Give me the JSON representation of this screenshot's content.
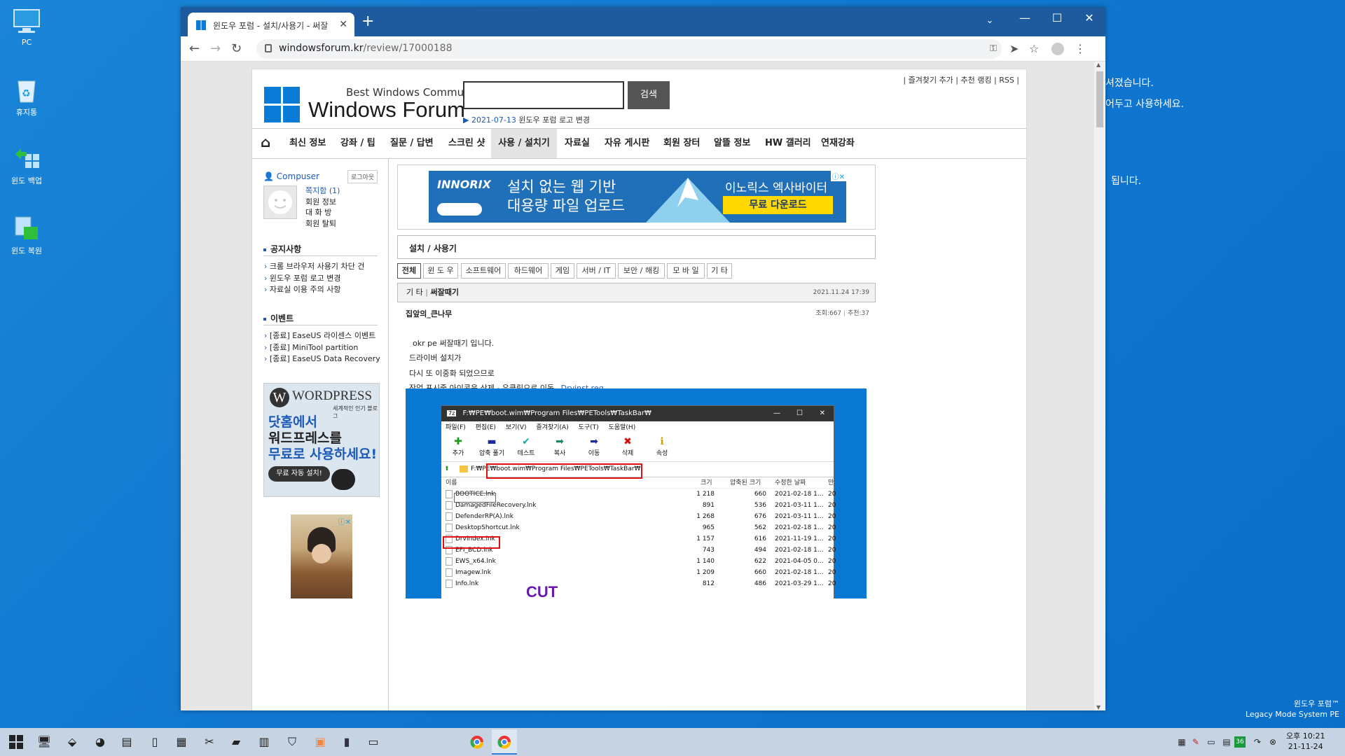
{
  "desktop": {
    "icons": [
      {
        "label": "PC"
      },
      {
        "label": "휴지통"
      },
      {
        "label": "윈도 백업"
      },
      {
        "label": "윈도 복원"
      }
    ],
    "bg_lines": [
      "셔졌습니다.",
      "어두고 사용하세요.",
      "됩니다."
    ],
    "watermark": {
      "line1": "윈도우 포럼™",
      "line2": "Legacy Mode System PE"
    }
  },
  "browser": {
    "tab_title": "윈도우 포럼 - 설치/사용기 - 써잘",
    "url_host": "windowsforum.kr",
    "url_path": "/review/17000188"
  },
  "site": {
    "logo_small": "Best Windows Community",
    "logo_big": "Windows Forum",
    "search_button": "검색",
    "notice_date": "2021-07-13",
    "notice_text": "윈도우 포럼 로고 변경",
    "top_links": [
      "즐겨찾기 추가",
      "추천 랭킹",
      "RSS"
    ],
    "gnb": [
      "최신 정보",
      "강좌 / 팁",
      "질문 / 답변",
      "스크린 샷",
      "사용 / 설치기",
      "자료실",
      "자유 게시판",
      "회원 장터",
      "알뜰 정보",
      "HW 갤러리",
      "연재강좌"
    ]
  },
  "sidebar": {
    "username": "Compuser",
    "logout": "로그아웃",
    "user_links": [
      "쪽지함 (1)",
      "회원 정보",
      "대 화 방",
      "회원 탈퇴"
    ],
    "notice_title": "공지사항",
    "notices": [
      "크롬 브라우저 사용기 차단 건",
      "윈도우 포럼 로고 변경",
      "자료실 이용 주의 사항"
    ],
    "event_title": "이벤트",
    "events": [
      "[종료] EaseUS 라이센스 이벤트",
      "[종료] MiniTool partition",
      "[종료] EaseUS Data Recovery"
    ],
    "ad": {
      "brand": "WORDPRESS",
      "tag": "세계적인 인기 블로그",
      "l1": "닷홈에서",
      "l2": "워드프레스를",
      "l3": "무료로 사용하세요!",
      "btn": "무료 자동 설치!"
    }
  },
  "banner": {
    "brand": "INNORIX",
    "l1": "설치 없는 웹 기반",
    "l2": "대용량 파일 업로드",
    "r1": "이노릭스 엑사바이터",
    "btn": "무료 다운로드"
  },
  "board": {
    "title": "설치 / 사용기",
    "categories": [
      "전체",
      "윈 도 우",
      "소프트웨어",
      "하드웨어",
      "게임",
      "서버 / IT",
      "보안 / 해킹",
      "모 바 일",
      "기 타"
    ],
    "post_cat": "기 타",
    "post_title": "써잘때기",
    "post_date": "2021.11.24 17:39",
    "author": "집앞의_큰나무",
    "views": "조회:667",
    "votes": "추천:37",
    "lines": [
      "okr pe  써잘때기 입니다.",
      "드라이버 설치가",
      "다시 또 이중화  되었으므로",
      "작업 표시줄 아이콘은 삭제 - 우클릭으로 이동"
    ],
    "link": "Drvinst.reg"
  },
  "zip": {
    "title": "F:₩PE₩boot.wim₩Program Files₩PETools₩TaskBar₩",
    "menu": [
      "파일(F)",
      "편집(E)",
      "보기(V)",
      "즐겨찾기(A)",
      "도구(T)",
      "도움말(H)"
    ],
    "tools": [
      {
        "label": "추가",
        "icon": "plus-icon",
        "color": "#1a9a1a",
        "glyph": "✚"
      },
      {
        "label": "압축 풀기",
        "icon": "minus-icon",
        "color": "#1a2a9a",
        "glyph": "▬"
      },
      {
        "label": "테스트",
        "icon": "check-icon",
        "color": "#18a8a0",
        "glyph": "✔"
      },
      {
        "label": "복사",
        "icon": "copy-icon",
        "color": "#1a8a6a",
        "glyph": "➡"
      },
      {
        "label": "이동",
        "icon": "move-icon",
        "color": "#1a2a9a",
        "glyph": "➡"
      },
      {
        "label": "삭제",
        "icon": "delete-icon",
        "color": "#d01010",
        "glyph": "✖"
      },
      {
        "label": "속성",
        "icon": "info-icon",
        "color": "#c9a000",
        "glyph": "ℹ"
      }
    ],
    "addr_prefix": "F:₩PE",
    "addr_rest": "₩boot.wim₩Program Files₩PETools₩TaskBar₩",
    "cols": [
      "이름",
      "크기",
      "압축된 크기",
      "수정한 날짜",
      "만"
    ],
    "rows": [
      {
        "name": "BOOTICE.lnk",
        "size": "1 218",
        "packed": "660",
        "date": "2021-02-18 1...",
        "extra": "20"
      },
      {
        "name": "DamagedFileRecovery.lnk",
        "size": "891",
        "packed": "536",
        "date": "2021-03-11 1...",
        "extra": "20"
      },
      {
        "name": "DefenderRP(A).lnk",
        "size": "1 268",
        "packed": "676",
        "date": "2021-03-11 1...",
        "extra": "20"
      },
      {
        "name": "DesktopShortcut.lnk",
        "size": "965",
        "packed": "562",
        "date": "2021-02-18 1...",
        "extra": "20"
      },
      {
        "name": "Drvindex.lnk",
        "size": "1 157",
        "packed": "616",
        "date": "2021-11-19 1...",
        "extra": "20"
      },
      {
        "name": "EFI_BCD.lnk",
        "size": "743",
        "packed": "494",
        "date": "2021-02-18 1...",
        "extra": "20"
      },
      {
        "name": "EWS_x64.lnk",
        "size": "1 140",
        "packed": "622",
        "date": "2021-04-05 0...",
        "extra": "20"
      },
      {
        "name": "Imagew.lnk",
        "size": "1 209",
        "packed": "660",
        "date": "2021-02-18 1...",
        "extra": "20"
      },
      {
        "name": "Info.lnk",
        "size": "812",
        "packed": "486",
        "date": "2021-03-29 1...",
        "extra": "20"
      }
    ],
    "cut": "CUT"
  },
  "taskbar": {
    "time": "오후 10:21",
    "date": "21-11-24",
    "tray_badge": "36"
  }
}
